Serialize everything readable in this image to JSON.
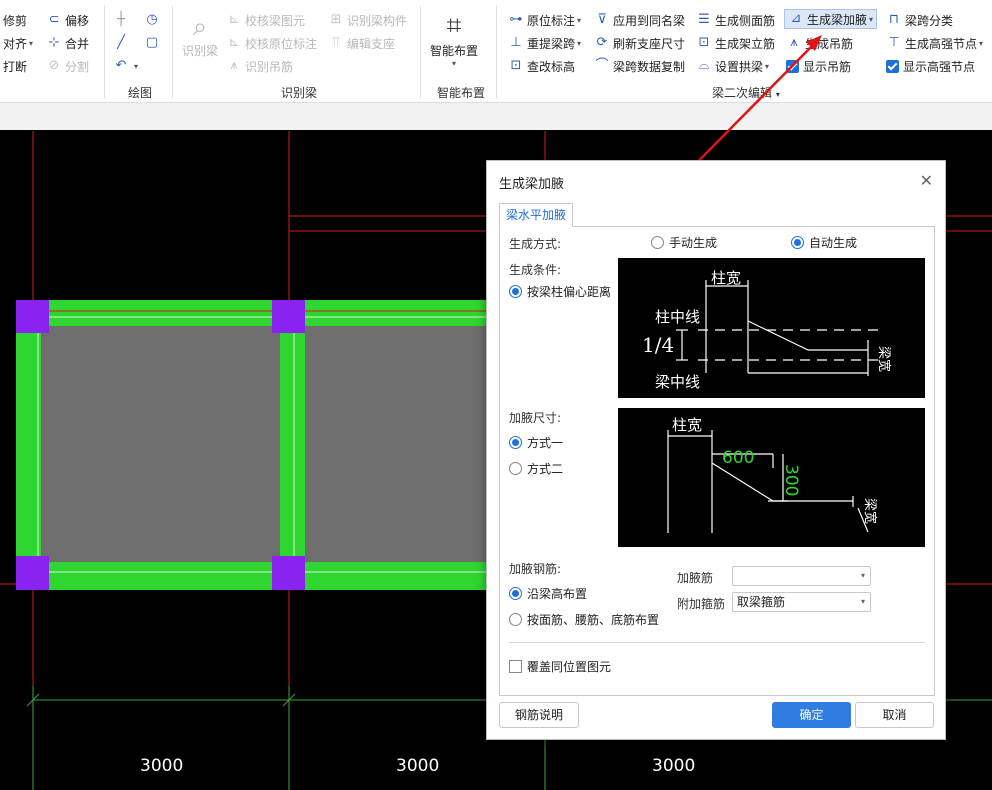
{
  "ribbon": {
    "col1": [
      "修剪",
      "对齐",
      "打断"
    ],
    "col2": [
      "偏移",
      "合并",
      "分割"
    ],
    "draw_label": "绘图",
    "recognize": {
      "big_label": "识别梁",
      "items": [
        "校核梁图元",
        "校核原位标注",
        "识别吊筋",
        "识别梁构件",
        "编辑支座"
      ],
      "group_label": "识别梁"
    },
    "smart": {
      "big_label": "智能布置",
      "group_label": "智能布置"
    },
    "beam2": {
      "col1": [
        "原位标注",
        "重提梁跨",
        "查改标高"
      ],
      "col2": [
        "应用到同名梁",
        "刷新支座尺寸",
        "梁跨数据复制"
      ],
      "col3": [
        "生成侧面筋",
        "生成架立筋",
        "设置拱梁"
      ],
      "col4": [
        "生成梁加腋",
        "生成吊筋",
        "显示吊筋"
      ],
      "col5": [
        "梁跨分类",
        "生成高强节点",
        "显示高强节点"
      ],
      "group_label": "梁二次编辑"
    }
  },
  "canvas": {
    "dimensions": [
      "3000",
      "3000",
      "3000"
    ]
  },
  "dialog": {
    "title": "生成梁加腋",
    "tab": "梁水平加腋",
    "gen_method_label": "生成方式:",
    "manual": "手动生成",
    "auto": "自动生成",
    "gen_condition_label": "生成条件:",
    "condition_option": "按梁柱偏心距离",
    "diagram1": {
      "col_width": "柱宽",
      "col_center": "柱中线",
      "quarter": "1/4",
      "beam_center": "梁中线",
      "beam_width": "梁宽"
    },
    "size_label": "加腋尺寸:",
    "method1": "方式一",
    "method2": "方式二",
    "diagram2": {
      "col_width": "柱宽",
      "len": "600",
      "height": "300",
      "beam_width": "梁宽"
    },
    "rebar_label": "加腋钢筋:",
    "rebar_opt1": "沿梁高布置",
    "rebar_opt2": "按面筋、腰筋、底筋布置",
    "haunch_rebar_label": "加腋筋",
    "haunch_rebar_value": "",
    "stirrup_label": "附加箍筋",
    "stirrup_value": "取梁箍筋",
    "overwrite": "覆盖同位置图元",
    "help_btn": "钢筋说明",
    "ok_btn": "确定",
    "cancel_btn": "取消"
  }
}
